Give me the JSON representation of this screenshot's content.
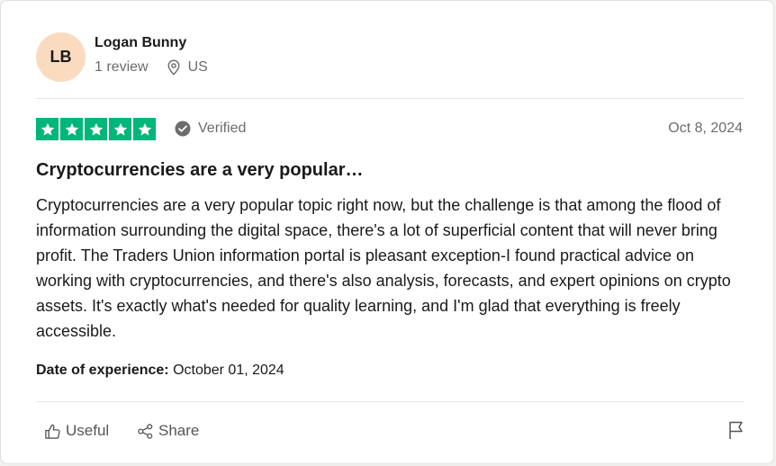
{
  "reviewer": {
    "initials": "LB",
    "name": "Logan Bunny",
    "review_count": "1 review",
    "country": "US",
    "avatar_color": "#fbdbbf"
  },
  "review": {
    "rating": 5,
    "star_color": "#00b67a",
    "verified_label": "Verified",
    "date": "Oct 8, 2024",
    "title": "Cryptocurrencies are a very popular…",
    "body": "Cryptocurrencies are a very popular topic right now, but the challenge is that among the flood of information surrounding the digital space, there's a lot of superficial content that will never bring profit. The Traders Union information portal is pleasant exception-I found practical advice on working with cryptocurrencies, and there's also analysis, forecasts, and expert opinions on crypto assets. It's exactly what's needed for quality learning, and I'm glad that everything is freely accessible.",
    "experience_label": "Date of experience:",
    "experience_date": "October 01, 2024"
  },
  "actions": {
    "useful_label": "Useful",
    "share_label": "Share",
    "useful_icon": "thumbs-up-icon",
    "share_icon": "share-icon",
    "flag_icon": "flag-icon"
  }
}
